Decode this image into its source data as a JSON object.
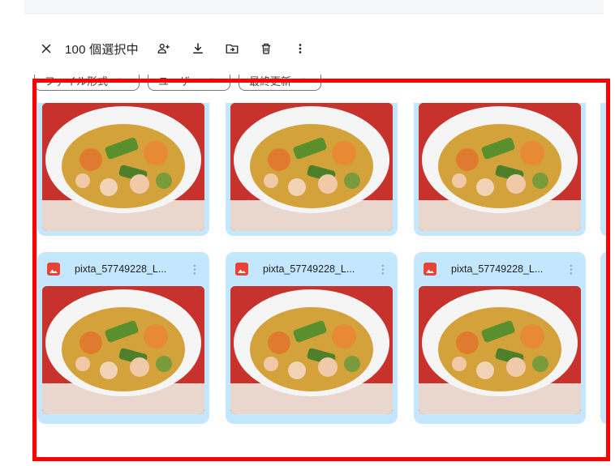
{
  "toolbar": {
    "selection_label": "100 個選択中",
    "icons": [
      "close-icon",
      "add-person-icon",
      "download-icon",
      "move-to-folder-icon",
      "trash-icon",
      "more-vert-icon"
    ]
  },
  "filters": [
    {
      "label": "ファイル形式"
    },
    {
      "label": "ユーザー"
    },
    {
      "label": "最終更新"
    }
  ],
  "files": {
    "top_row": [
      {},
      {},
      {}
    ],
    "bottom_row": [
      {
        "name": "pixta_57749228_L..."
      },
      {
        "name": "pixta_57749228_L..."
      },
      {
        "name": "pixta_57749228_L..."
      }
    ]
  },
  "colors": {
    "card_bg": "#c2e7ff",
    "image_file_icon": "#ea4335",
    "highlight_box": "#ff0000"
  }
}
